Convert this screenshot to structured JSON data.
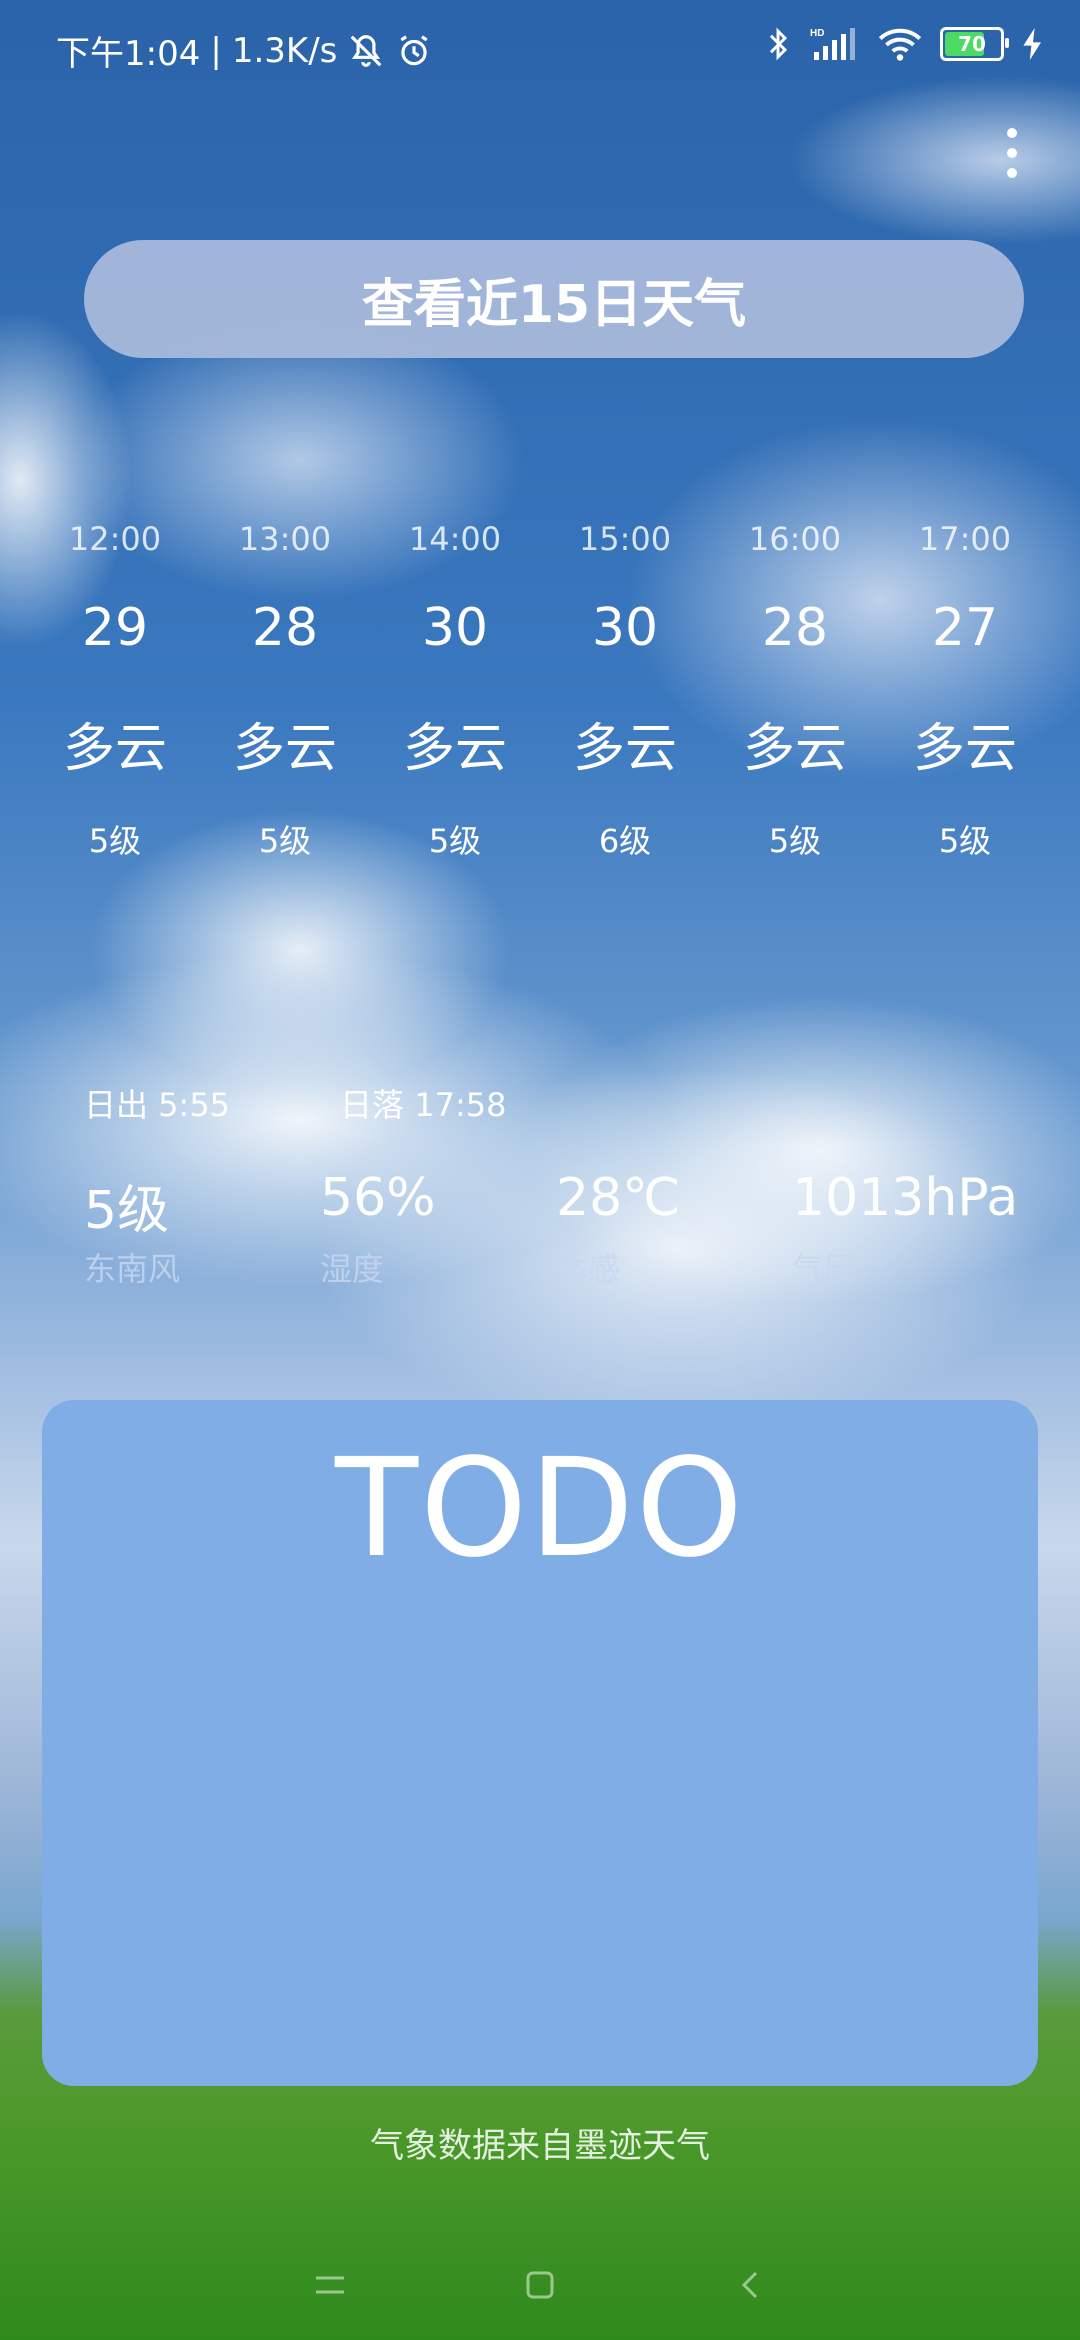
{
  "status_bar": {
    "time": "下午1:04",
    "speed": "1.3K/s",
    "battery": "70",
    "icons": [
      "mute-icon",
      "alarm-icon",
      "bluetooth-icon",
      "signal-icon",
      "wifi-icon",
      "battery-icon",
      "charging-icon"
    ]
  },
  "header": {
    "forecast_button": "查看近15日天气"
  },
  "hourly": [
    {
      "time": "12:00",
      "temp": "29",
      "condition": "多云",
      "wind": "5级"
    },
    {
      "time": "13:00",
      "temp": "28",
      "condition": "多云",
      "wind": "5级"
    },
    {
      "time": "14:00",
      "temp": "30",
      "condition": "多云",
      "wind": "5级"
    },
    {
      "time": "15:00",
      "temp": "30",
      "condition": "多云",
      "wind": "6级"
    },
    {
      "time": "16:00",
      "temp": "28",
      "condition": "多云",
      "wind": "5级"
    },
    {
      "time": "17:00",
      "temp": "27",
      "condition": "多云",
      "wind": "5级"
    }
  ],
  "sun": {
    "sunrise": "日出 5:55",
    "sunset": "日落 17:58"
  },
  "stats": [
    {
      "value": "5级",
      "label": "东南风"
    },
    {
      "value": "56%",
      "label": "湿度"
    },
    {
      "value": "28℃",
      "label": "体感"
    },
    {
      "value": "1013hPa",
      "label": "气压"
    }
  ],
  "todo": {
    "title": "TODO"
  },
  "footer": {
    "credit": "气象数据来自墨迹天气"
  },
  "colors": {
    "todo_card": "#81ade6",
    "forecast_button": "#aabcdc"
  }
}
